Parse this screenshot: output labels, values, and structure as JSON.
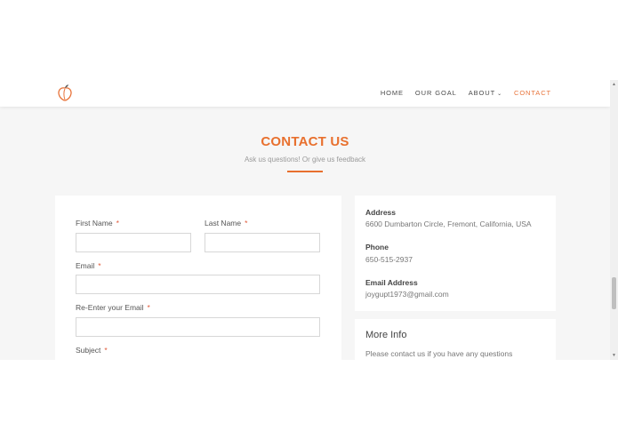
{
  "nav": {
    "logo_icon": "peach-icon",
    "items": [
      {
        "label": "HOME"
      },
      {
        "label": "OUR GOAL"
      },
      {
        "label": "ABOUT"
      },
      {
        "label": "CONTACT"
      }
    ],
    "about_caret": "⌄"
  },
  "hero": {
    "title": "CONTACT US",
    "subtitle": "Ask us questions! Or give us feedback"
  },
  "form": {
    "required_marker": "*",
    "fields": {
      "first_name": {
        "label": "First Name",
        "value": ""
      },
      "last_name": {
        "label": "Last Name",
        "value": ""
      },
      "email": {
        "label": "Email",
        "value": ""
      },
      "reenter_email": {
        "label": "Re-Enter your Email",
        "value": ""
      },
      "subject": {
        "label": "Subject"
      }
    }
  },
  "contact_info": {
    "address_title": "Address",
    "address_value": "6600 Dumbarton Circle, Fremont, California, USA",
    "phone_title": "Phone",
    "phone_value": "650-515-2937",
    "email_title": "Email Address",
    "email_value": "joygupt1973@gmail.com"
  },
  "more_info": {
    "title": "More Info",
    "text": "Please contact us if you have any questions"
  },
  "colors": {
    "accent": "#e8702e",
    "required": "#e05a3a",
    "background": "#f6f6f6"
  },
  "scrollbar": {
    "up_icon": "▲",
    "down_icon": "▼"
  }
}
